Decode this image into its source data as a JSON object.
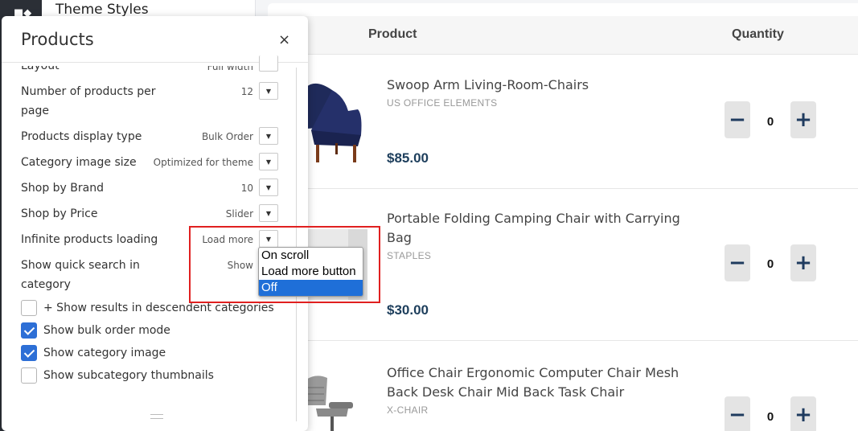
{
  "app": {
    "sidebar_title": "Theme Styles"
  },
  "panel": {
    "title": "Products",
    "close_label": "×",
    "partial_row": {
      "label": "Layout",
      "value": "Full width"
    },
    "settings": [
      {
        "label_line1": "Number of products per",
        "label_line2": "page",
        "value": "12"
      },
      {
        "label_line1": "Products display type",
        "value": "Bulk Order"
      },
      {
        "label_line1": "Category image size",
        "value": "Optimized for theme"
      },
      {
        "label_line1": "Shop by Brand",
        "value": "10"
      },
      {
        "label_line1": "Shop by Price",
        "value": "Slider"
      },
      {
        "label_line1": "Infinite products loading",
        "value": "Load more"
      },
      {
        "label_line1": "Show quick search in",
        "label_line2": "category",
        "value": "Show"
      }
    ],
    "checkboxes": [
      {
        "label": "+ Show results in descendent categories",
        "checked": false
      },
      {
        "label": "Show bulk order mode",
        "checked": true
      },
      {
        "label": "Show category image",
        "checked": true
      },
      {
        "label": "Show subcategory thumbnails",
        "checked": false
      }
    ],
    "dropdown_options": [
      {
        "label": "On scroll",
        "selected": false
      },
      {
        "label": "Load more button",
        "selected": false
      },
      {
        "label": "Off",
        "selected": true
      }
    ]
  },
  "table": {
    "col_product": "Product",
    "col_quantity": "Quantity"
  },
  "products": [
    {
      "name_line1": "Swoop Arm Living-Room-Chairs",
      "name_line2": "",
      "brand": "US OFFICE ELEMENTS",
      "price": "$85.00",
      "qty": "0"
    },
    {
      "name_line1": "Portable Folding Camping Chair with Carrying",
      "name_line2": "Bag",
      "brand": "STAPLES",
      "price": "$30.00",
      "qty": "0"
    },
    {
      "name_line1": "Office Chair Ergonomic Computer Chair Mesh",
      "name_line2": "Back Desk Chair Mid Back Task Chair",
      "brand": "X-CHAIR",
      "price": "",
      "qty": "0"
    }
  ],
  "qty_controls": {
    "minus": "−",
    "plus": "+"
  },
  "colors": {
    "accent": "#2d6fd6",
    "price": "#1d3e5c",
    "highlight": "#e02020",
    "qty_icon": "#1f3b5f"
  }
}
